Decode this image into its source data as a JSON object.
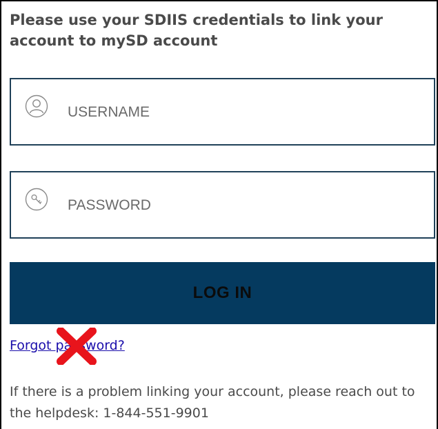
{
  "login_form": {
    "intro_text": "Please use your SDIIS credentials to link your account to mySD account",
    "username": {
      "icon": "user-circle-icon",
      "placeholder": "USERNAME",
      "value": ""
    },
    "password": {
      "icon": "key-circle-icon",
      "placeholder": "PASSWORD",
      "value": ""
    },
    "login_button_label": "LOG IN",
    "forgot_password_link": "Forgot password?",
    "help_text": "If there is a problem linking your account, please reach out to the helpdesk: 1-844-551-9901"
  },
  "annotation": {
    "icon": "red-x-mark-icon",
    "color": "#e8141c"
  },
  "colors": {
    "button_background": "#053a5f",
    "field_border": "#1f4058",
    "link": "#1a0dab",
    "body_text": "#4a4a4a"
  }
}
